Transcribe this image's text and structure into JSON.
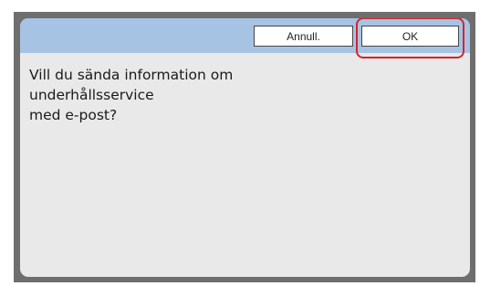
{
  "dialog": {
    "buttons": {
      "cancel_label": "Annull.",
      "ok_label": "OK"
    },
    "message_lines": [
      "Vill du sända information om",
      "underhållsservice",
      "med e-post?"
    ]
  },
  "colors": {
    "header": "#a7c3e3",
    "dialog_background": "#e9e9e9",
    "frame": "#6e6e6e",
    "highlight": "#d8232a"
  }
}
